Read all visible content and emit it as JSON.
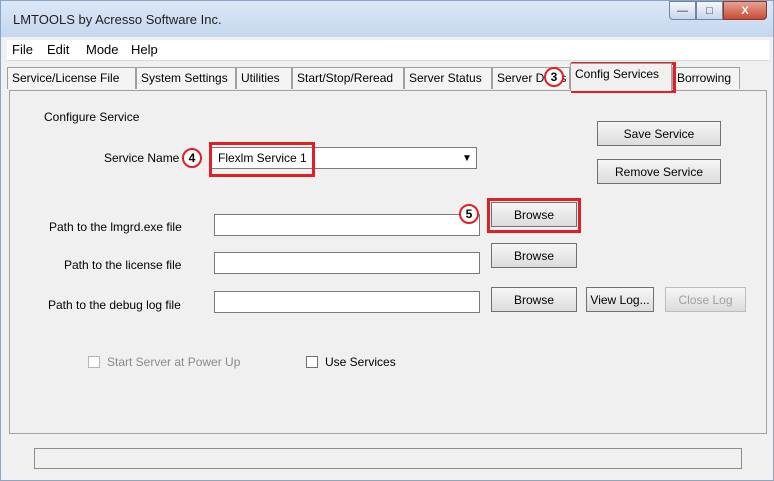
{
  "window": {
    "title": "LMTOOLS by Acresso Software Inc.",
    "controls": {
      "minimize": "—",
      "maximize": "□",
      "close": "X"
    }
  },
  "menu": [
    "File",
    "Edit",
    "Mode",
    "Help"
  ],
  "tabs": [
    "Service/License File",
    "System Settings",
    "Utilities",
    "Start/Stop/Reread",
    "Server Status",
    "Server Diags",
    "Config Services",
    "Borrowing"
  ],
  "active_tab": "Config Services",
  "config": {
    "section_label": "Configure Service",
    "service_name_label": "Service Name",
    "service_name_value": "Flexlm Service 1",
    "save_service": "Save Service",
    "remove_service": "Remove Service",
    "lmgrd_label": "Path to the lmgrd.exe file",
    "lmgrd_value": "",
    "license_label": "Path to the license file",
    "license_value": "",
    "debug_label": "Path to the debug log file",
    "debug_value": "",
    "browse": "Browse",
    "view_log": "View Log...",
    "close_log": "Close Log",
    "start_at_power_up": "Start Server at Power Up",
    "use_services": "Use Services"
  },
  "annotations": [
    "3",
    "4",
    "5"
  ],
  "colors": {
    "annotation": "#e31f26",
    "titlebar": "#c5d8ef"
  }
}
